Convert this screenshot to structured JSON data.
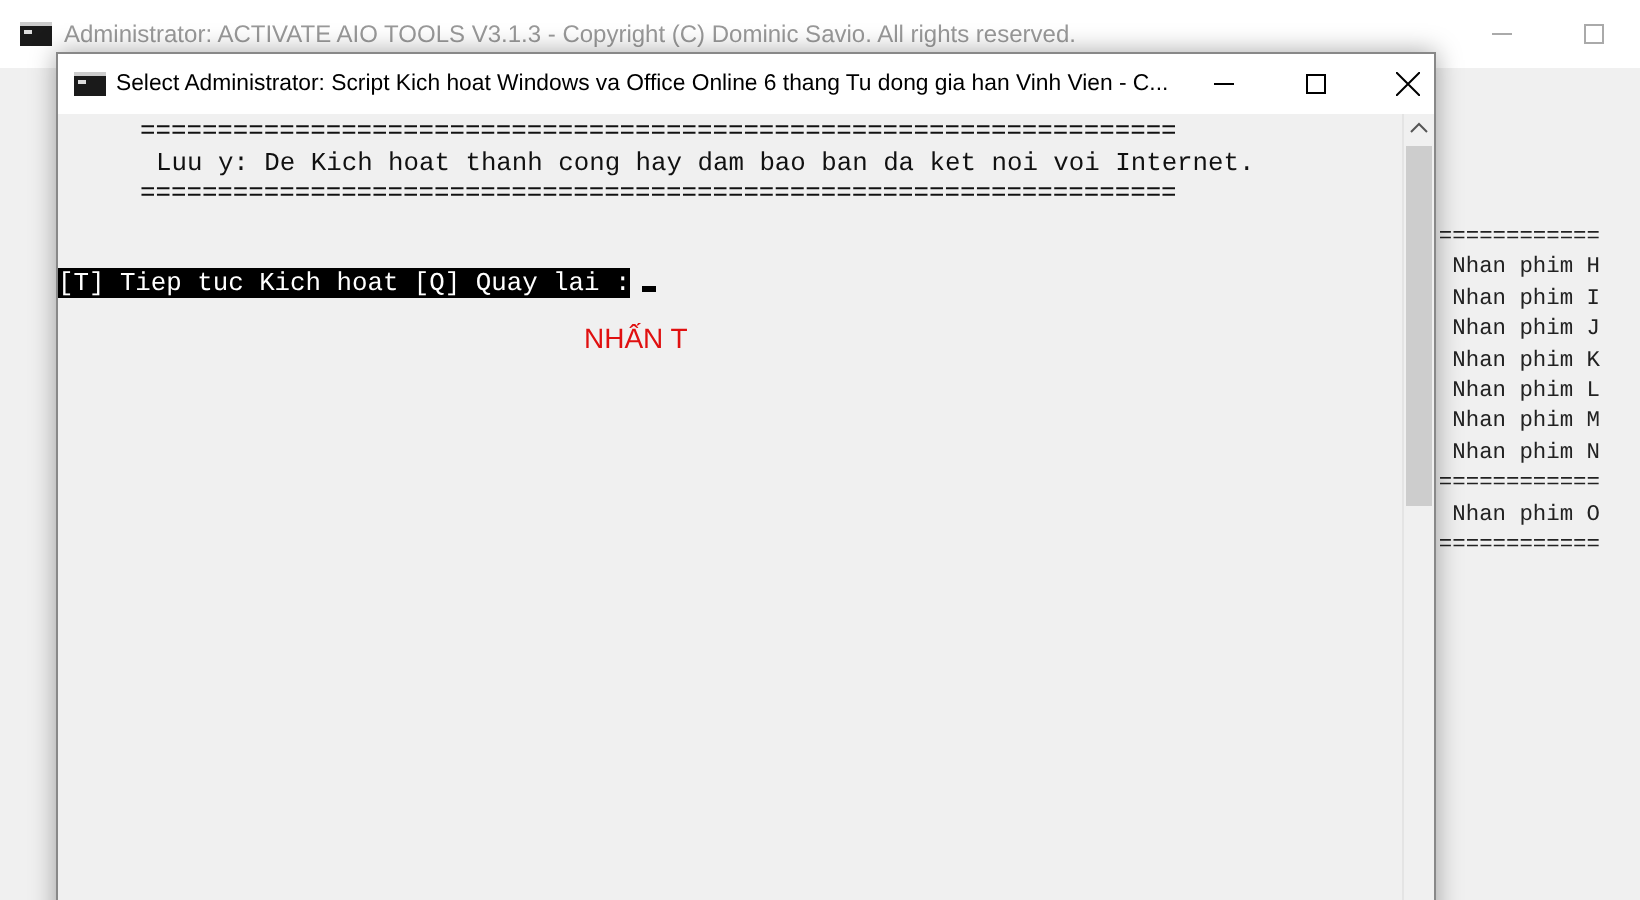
{
  "back_window": {
    "title": "Administrator:  ACTIVATE AIO TOOLS V3.1.3 - Copyright (C) Dominic Savio. All rights reserved.",
    "console_lines": [
      {
        "kind": "rule",
        "text": "============"
      },
      {
        "kind": "text",
        "text": "Nhan phim H"
      },
      {
        "kind": "text",
        "text": "Nhan phim I"
      },
      {
        "kind": "text",
        "text": "Nhan phim J"
      },
      {
        "kind": "text",
        "text": "Nhan phim K"
      },
      {
        "kind": "text",
        "text": "Nhan phim L"
      },
      {
        "kind": "text",
        "text": "Nhan phim M"
      },
      {
        "kind": "text",
        "text": "Nhan phim N"
      },
      {
        "kind": "rule",
        "text": "============"
      },
      {
        "kind": "text",
        "text": "Nhan phim O"
      },
      {
        "kind": "rule",
        "text": "============"
      }
    ]
  },
  "front_window": {
    "title": "Select Administrator:  Script Kich hoat Windows va Office Online 6 thang Tu dong gia han Vinh Vien - C...",
    "console_lines": [
      {
        "kind": "rule",
        "text": "==================================================================="
      },
      {
        "kind": "text",
        "text": "Luu y: De Kich hoat thanh cong hay dam bao ban da ket noi voi Internet."
      },
      {
        "kind": "rule",
        "text": "==================================================================="
      },
      {
        "kind": "prompt",
        "text": "[T] Tiep tuc Kich hoat [Q] Quay lai :"
      }
    ],
    "annotation": "NHẤN T"
  }
}
